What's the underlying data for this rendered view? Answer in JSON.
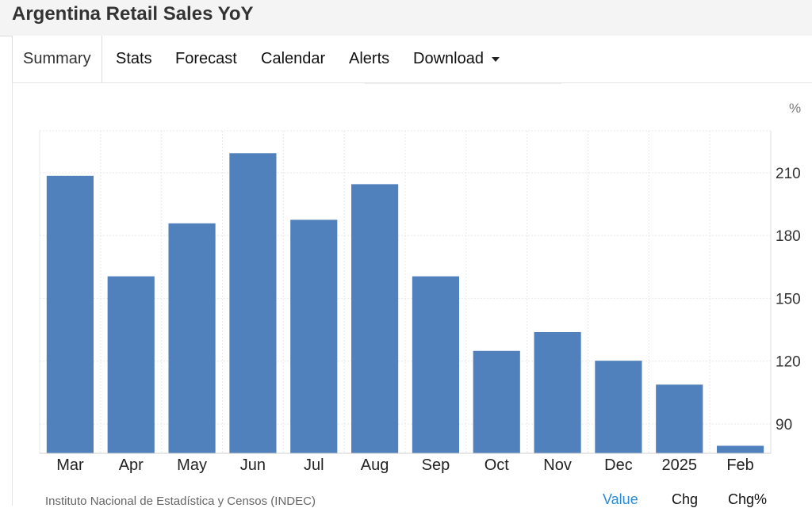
{
  "header": {
    "title": "Argentina Retail Sales YoY"
  },
  "tabs": [
    {
      "label": "Summary"
    },
    {
      "label": "Stats"
    },
    {
      "label": "Forecast"
    },
    {
      "label": "Calendar"
    },
    {
      "label": "Alerts"
    },
    {
      "label": "Download"
    }
  ],
  "footer": {
    "source": "Instituto Nacional de Estadística y Censos (INDEC)",
    "links": [
      "Value",
      "Chg",
      "Chg%"
    ]
  },
  "colors": {
    "bar": "#5181bd",
    "grid": "#e8e8e8",
    "link": "#2a8bd6"
  },
  "chart_data": {
    "type": "bar",
    "unit": "%",
    "categories": [
      "Mar",
      "Apr",
      "May",
      "Jun",
      "Jul",
      "Aug",
      "Sep",
      "Oct",
      "Nov",
      "Dec",
      "2025",
      "Feb"
    ],
    "values": [
      208.5,
      160.5,
      185.8,
      219.3,
      187.5,
      204.5,
      160.5,
      124.9,
      133.9,
      120.2,
      108.8,
      79.6
    ],
    "y_ticks": [
      90,
      120,
      150,
      180,
      210
    ],
    "ylim": [
      76,
      230
    ],
    "y_axis_side": "right",
    "grid": true
  }
}
